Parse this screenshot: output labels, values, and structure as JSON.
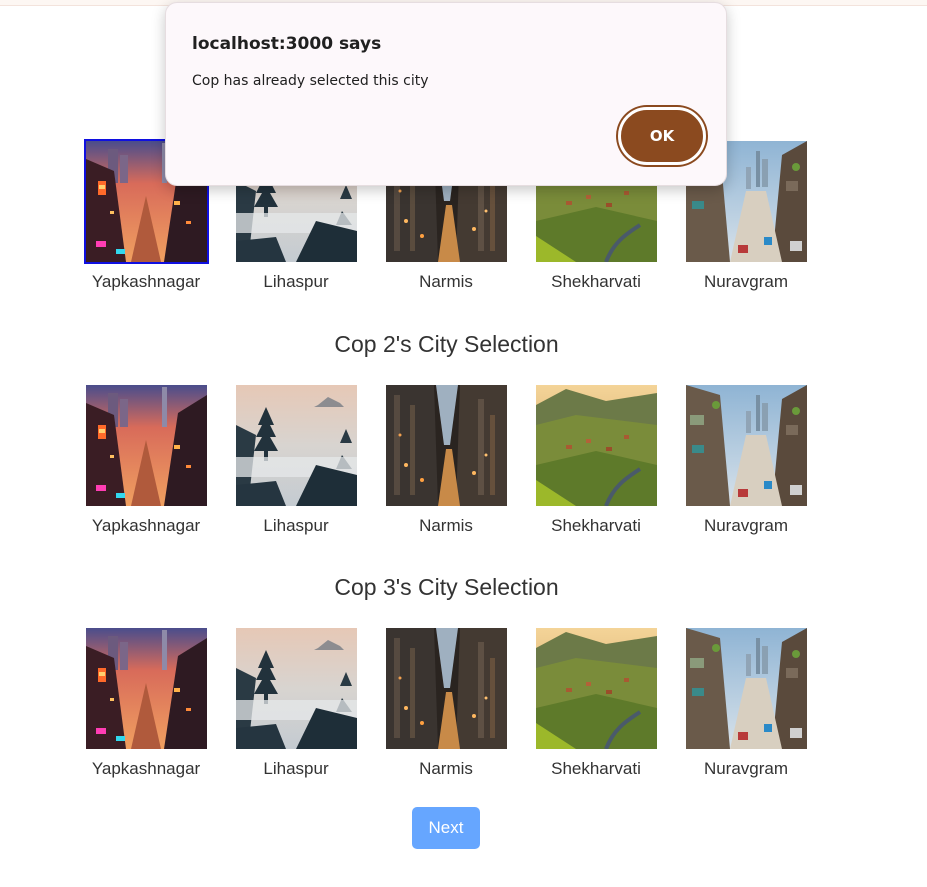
{
  "dialog": {
    "title": "localhost:3000 says",
    "message": "Cop has already selected this city",
    "ok_label": "OK"
  },
  "sections": [
    {
      "title": "",
      "selected_city": "Yapkashnagar",
      "cities": [
        {
          "name": "Yapkashnagar",
          "image": "neon-city-street-image"
        },
        {
          "name": "Lihaspur",
          "image": "misty-pagoda-image"
        },
        {
          "name": "Narmis",
          "image": "skyscraper-canyon-image"
        },
        {
          "name": "Shekharvati",
          "image": "green-hill-village-image"
        },
        {
          "name": "Nuravgram",
          "image": "hillside-street-image"
        }
      ]
    },
    {
      "title": "Cop 2's City Selection",
      "selected_city": "",
      "cities": [
        {
          "name": "Yapkashnagar",
          "image": "neon-city-street-image"
        },
        {
          "name": "Lihaspur",
          "image": "misty-pagoda-image"
        },
        {
          "name": "Narmis",
          "image": "skyscraper-canyon-image"
        },
        {
          "name": "Shekharvati",
          "image": "green-hill-village-image"
        },
        {
          "name": "Nuravgram",
          "image": "hillside-street-image"
        }
      ]
    },
    {
      "title": "Cop 3's City Selection",
      "selected_city": "",
      "cities": [
        {
          "name": "Yapkashnagar",
          "image": "neon-city-street-image"
        },
        {
          "name": "Lihaspur",
          "image": "misty-pagoda-image"
        },
        {
          "name": "Narmis",
          "image": "skyscraper-canyon-image"
        },
        {
          "name": "Shekharvati",
          "image": "green-hill-village-image"
        },
        {
          "name": "Nuravgram",
          "image": "hillside-street-image"
        }
      ]
    }
  ],
  "next_label": "Next",
  "colors": {
    "selected_border": "#1010e0",
    "next_button": "#66a6ff",
    "ok_button": "#8b4a1f"
  }
}
